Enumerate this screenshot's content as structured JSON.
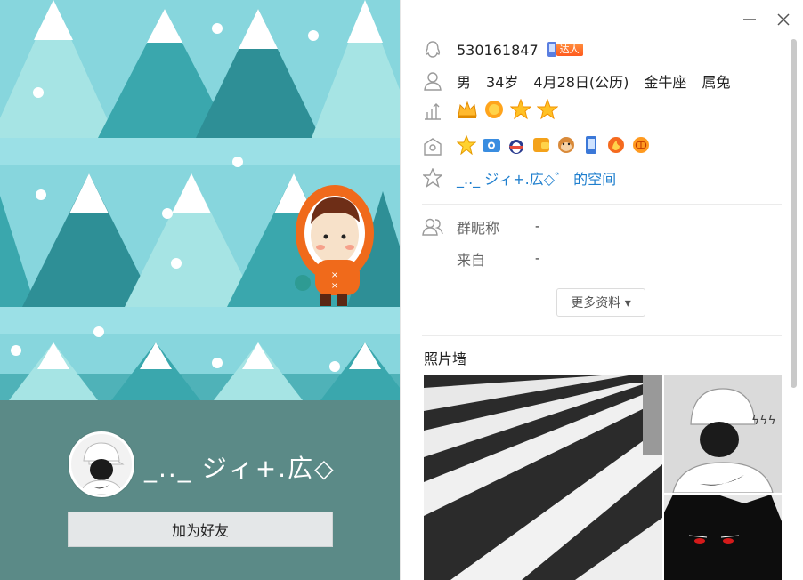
{
  "window": {
    "minimize_icon": "minimize-icon",
    "close_icon": "close-icon"
  },
  "profile": {
    "nickname": "_.._ ジィ+.広◇",
    "add_friend_label": "加为好友"
  },
  "info": {
    "qq_number": "530161847",
    "daren_tag": "达人",
    "gender": "男",
    "age": "34岁",
    "birthday": "4月28日(公历)",
    "zodiac": "金牛座",
    "chinese_zodiac": "属兔",
    "space_link": "_.._ ジィ+.広◇゛ 的空间"
  },
  "group": {
    "group_nickname_label": "群昵称",
    "group_nickname_value": "-",
    "from_label": "来自",
    "from_value": "-"
  },
  "more_button_label": "更多资料 ▾",
  "photo_wall_title": "照片墙",
  "colors": {
    "scene_bg": "#87d6dd",
    "profile_bg": "#5b8a87",
    "link": "#1f7fce"
  }
}
